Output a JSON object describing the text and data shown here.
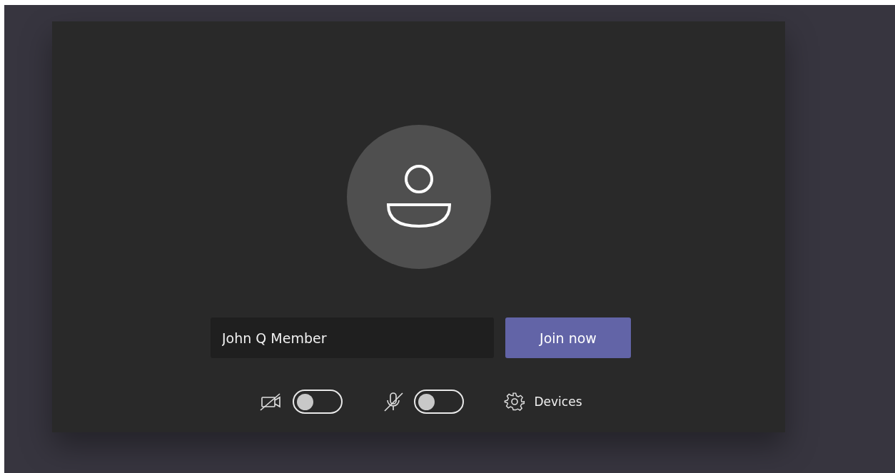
{
  "name_field": {
    "value": "John Q Member"
  },
  "join_button": {
    "label": "Join now"
  },
  "controls": [
    {
      "kind": "camera",
      "on": false
    },
    {
      "kind": "mic",
      "on": false
    }
  ],
  "devices": {
    "label": "Devices"
  }
}
